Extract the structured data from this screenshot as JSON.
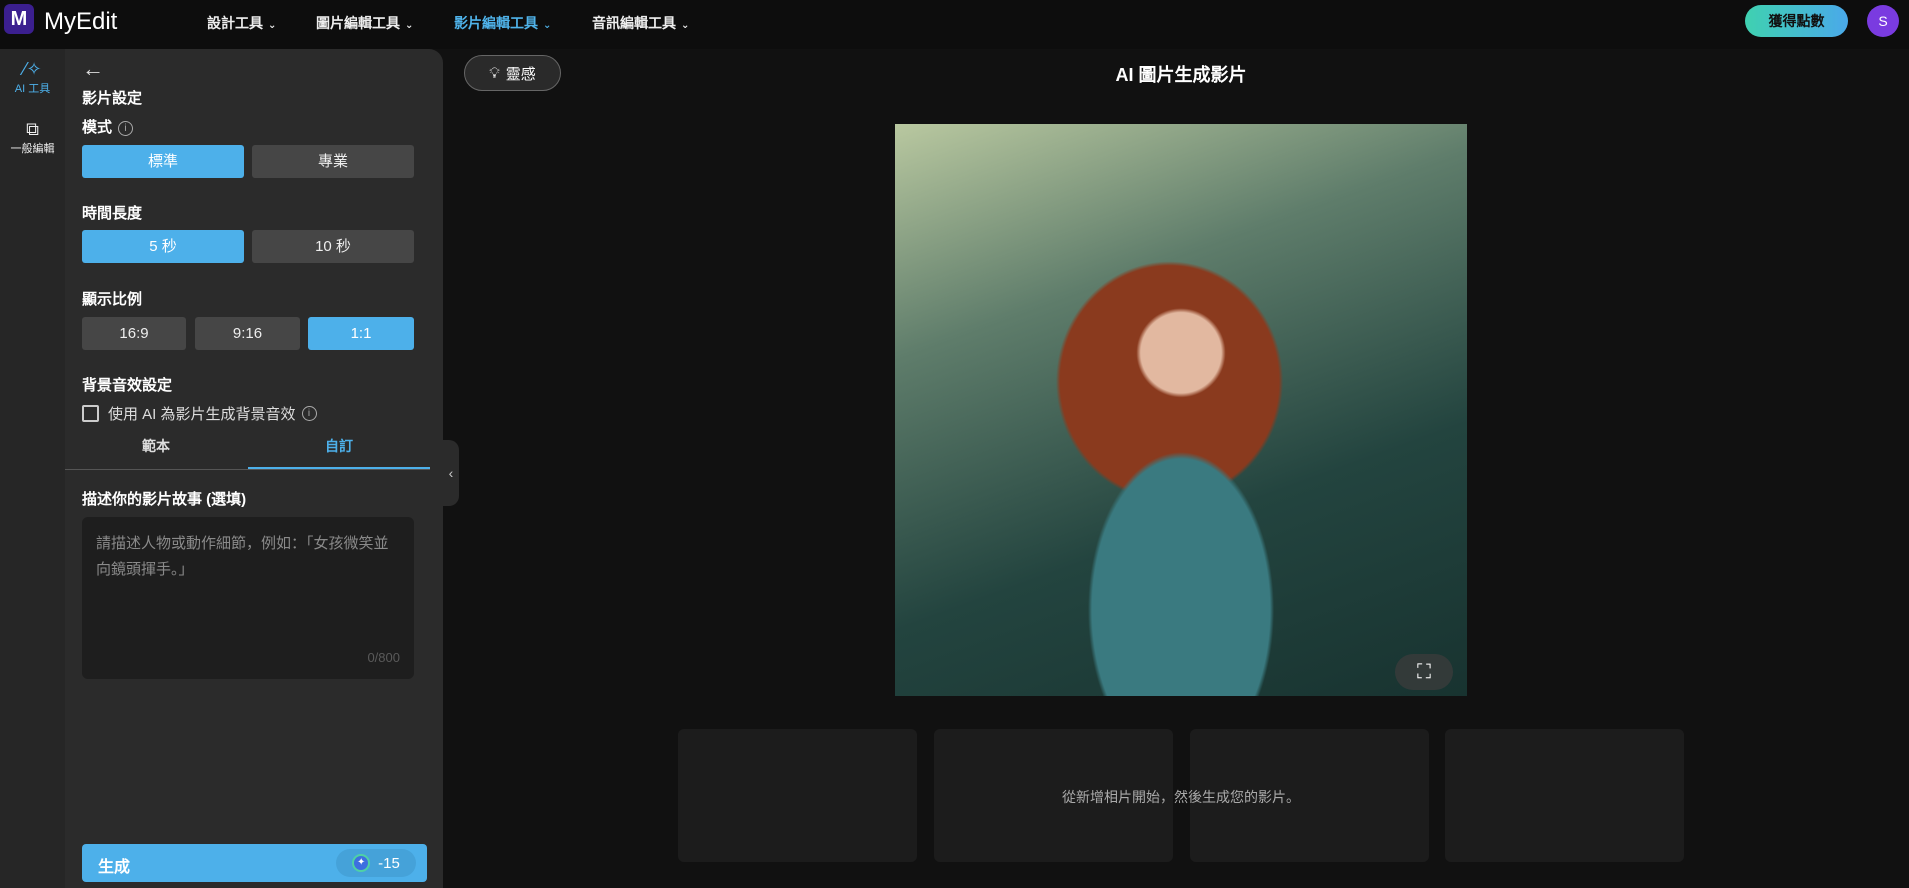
{
  "header": {
    "logo_mark": "M",
    "logo_text": "MyEdit",
    "nav": [
      {
        "label": "設計工具"
      },
      {
        "label": "圖片編輯工具"
      },
      {
        "label": "影片編輯工具",
        "active": true
      },
      {
        "label": "音訊編輯工具"
      }
    ],
    "points_label": "獲得點數",
    "avatar_initial": "S"
  },
  "rail": [
    {
      "label": "AI 工具",
      "icon": "magic-wand-icon",
      "active": true
    },
    {
      "label": "一般編輯",
      "icon": "layers-icon"
    }
  ],
  "panel": {
    "title": "影片設定",
    "mode": {
      "label": "模式",
      "options": [
        "標準",
        "專業"
      ],
      "selected": 0
    },
    "duration": {
      "label": "時間長度",
      "options": [
        "5 秒",
        "10 秒"
      ],
      "selected": 0
    },
    "ratio": {
      "label": "顯示比例",
      "options": [
        "16:9",
        "9:16",
        "1:1"
      ],
      "selected": 2
    },
    "audio": {
      "label": "背景音效設定",
      "checkbox_label": "使用 AI 為影片生成背景音效",
      "checked": false
    },
    "tabs": [
      "範本",
      "自訂"
    ],
    "active_tab": 1,
    "story": {
      "label": "描述你的影片故事 (選填)",
      "placeholder": "請描述人物或動作細節，例如：「女孩微笑並向鏡頭揮手。」",
      "counter": "0/800"
    },
    "generate": {
      "label": "生成",
      "cost": "-15"
    }
  },
  "main": {
    "inspiration_label": "靈感",
    "title": "AI 圖片生成影片",
    "empty_text": "從新增相片開始，然後生成您的影片。"
  },
  "colors": {
    "accent": "#4db0ea",
    "brand": "#3b1f8f"
  }
}
